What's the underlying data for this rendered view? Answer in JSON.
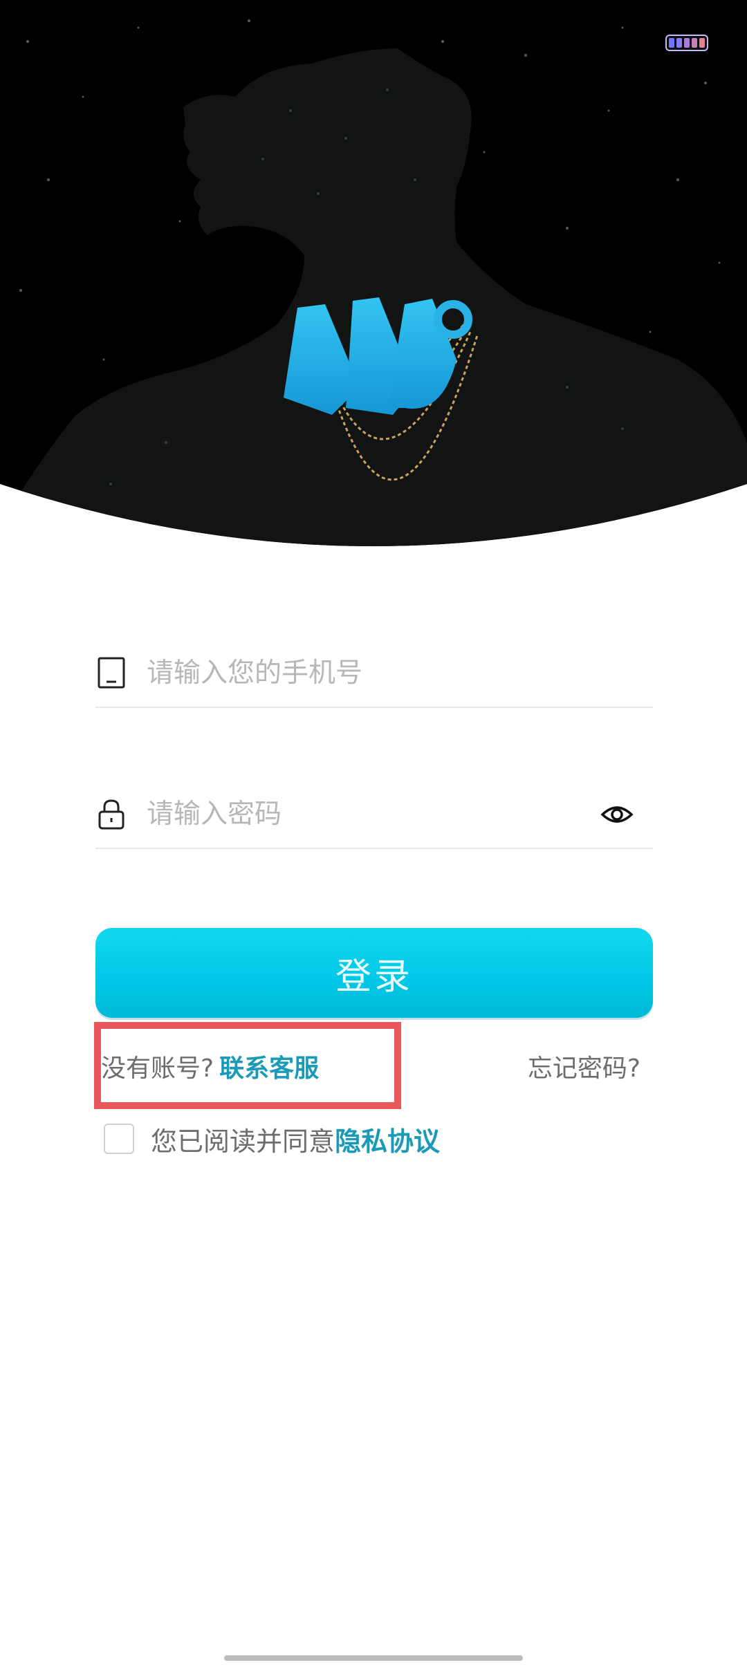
{
  "status": {
    "battery_colors": [
      "#6f79ff",
      "#8a7cf2",
      "#a57ee0",
      "#c97fb8",
      "#e67f93"
    ]
  },
  "login": {
    "phone_placeholder": "请输入您的手机号",
    "password_placeholder": "请输入密码",
    "button_label": "登录",
    "no_account_text": "没有账号?",
    "contact_label": "联系客服",
    "forgot_label": "忘记密码?",
    "agree_text": "您已阅读并同意",
    "privacy_label": "隐私协议"
  },
  "colors": {
    "accent": "#00c7e6",
    "link": "#1b9ab8",
    "highlight": "#e8575a",
    "logo": "#22b6e8"
  },
  "icons": {
    "phone": "phone-icon",
    "lock": "lock-icon",
    "eye": "eye-icon",
    "logo": "app-logo"
  }
}
